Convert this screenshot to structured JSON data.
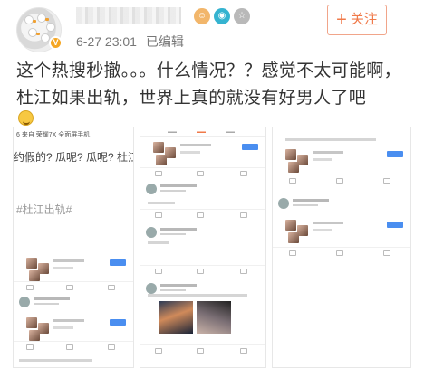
{
  "post": {
    "timestamp": "6-27 23:01",
    "edited_label": "已编辑",
    "follow_label": "关注",
    "text": "这个热搜秒撤。。。什么情况？？感觉不太可能啊，杜江如果出轨，世界上真的就没有好男人了吧"
  },
  "screenshots": {
    "left": {
      "caption": "6 来自 荣耀7X 全面屏手机",
      "headline": "约假的? 瓜呢? 瓜呢? 杜江和",
      "hashtag": "#杜江出轨#"
    }
  },
  "colors": {
    "accent": "#f07a4a",
    "follow_border": "#f1a58a",
    "vip_badge": "#f5a623",
    "link_blue": "#4a8ef0"
  }
}
